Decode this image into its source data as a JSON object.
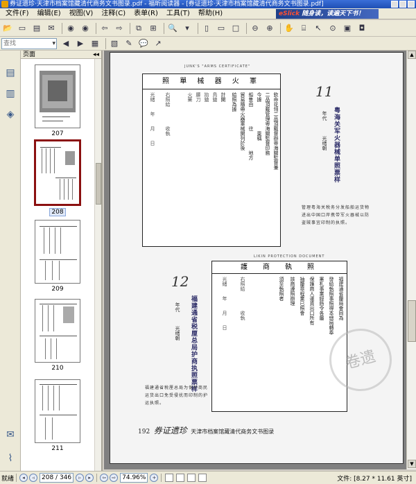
{
  "window": {
    "title": "券证遗珍·天津市档案馆藏清代商务文书图录.pdf - 福昕阅读器 - [券证遗珍·天津市档案馆藏清代商务文书图录.pdf]"
  },
  "menu": {
    "items": [
      "文件(F)",
      "编辑(E)",
      "视图(V)",
      "注释(C)",
      "表单(R)",
      "工具(T)",
      "帮助(H)"
    ],
    "ad_prefix": "eSlick",
    "ad_text": "随身读，读遍天下书！"
  },
  "toolbar": {
    "zoom_placeholder": "查找"
  },
  "pages_panel": {
    "title": "页面",
    "thumbnails": [
      {
        "label": "207"
      },
      {
        "label": "208",
        "selected": true
      },
      {
        "label": "209"
      },
      {
        "label": "210"
      },
      {
        "label": "211"
      }
    ]
  },
  "document": {
    "doc1": {
      "caption": "JUNK'S \"ARMS CERTIFICATE\"",
      "header": "照 單 械 器 火 軍",
      "cols": [
        "欽命花翎二品頂戴督辦粵海關監督兼",
        "二品頂戴管理粵海關監督印務",
        "今據　　　　　　稟稱　　　　　　",
        "船隻由　　　　往　　　　地方",
        "貿易隨帶火器軍械開列於後",
        "給照為據",
        "計開",
        "鳥鎗",
        "抬鎗",
        "腰刀",
        "火藥",
        "右照給　　　　收執",
        "光緒　　年　　月　　日"
      ],
      "number": "11",
      "title": "粤海关军火器械单照票样",
      "era_label": "年代",
      "era": "光绪朝",
      "desc": "管理粤海关税务分发船舶运货物进出中国口岸携带军火器械以防盗贼事宜印制的执照。"
    },
    "doc2": {
      "caption": "LIKIN PROTECTION DOCUMENT",
      "header": "護　商　執　照",
      "cols": [
        "福建通省釐局會同為",
        "發給執照事照得本總局轉奉",
        "憲札事業經飭令各屬",
        "保護商人運貨出口所有",
        "抽釐章程業已照會",
        "該商遵照辦理",
        "須至執照者",
        "右照給　　　　收執",
        "光緒　　年　　月　　日"
      ],
      "number": "12",
      "title": "福建通省税厘总局护商执照票样",
      "era_label": "年代",
      "era": "光绪朝",
      "desc": "福建通省税厘总局为保护商民运货出口免受侵扰而印制的护运执照。",
      "stamp": "卷遗"
    },
    "footer": {
      "page_number": "192",
      "book_title": "券证遗珍",
      "subtitle": "天津市档案馆藏清代商务文书图录"
    }
  },
  "status": {
    "state": "就绪",
    "page_field": "208 / 346",
    "zoom": "74.96%",
    "doc_size": "文件: [8.27 * 11.61 英寸]"
  }
}
